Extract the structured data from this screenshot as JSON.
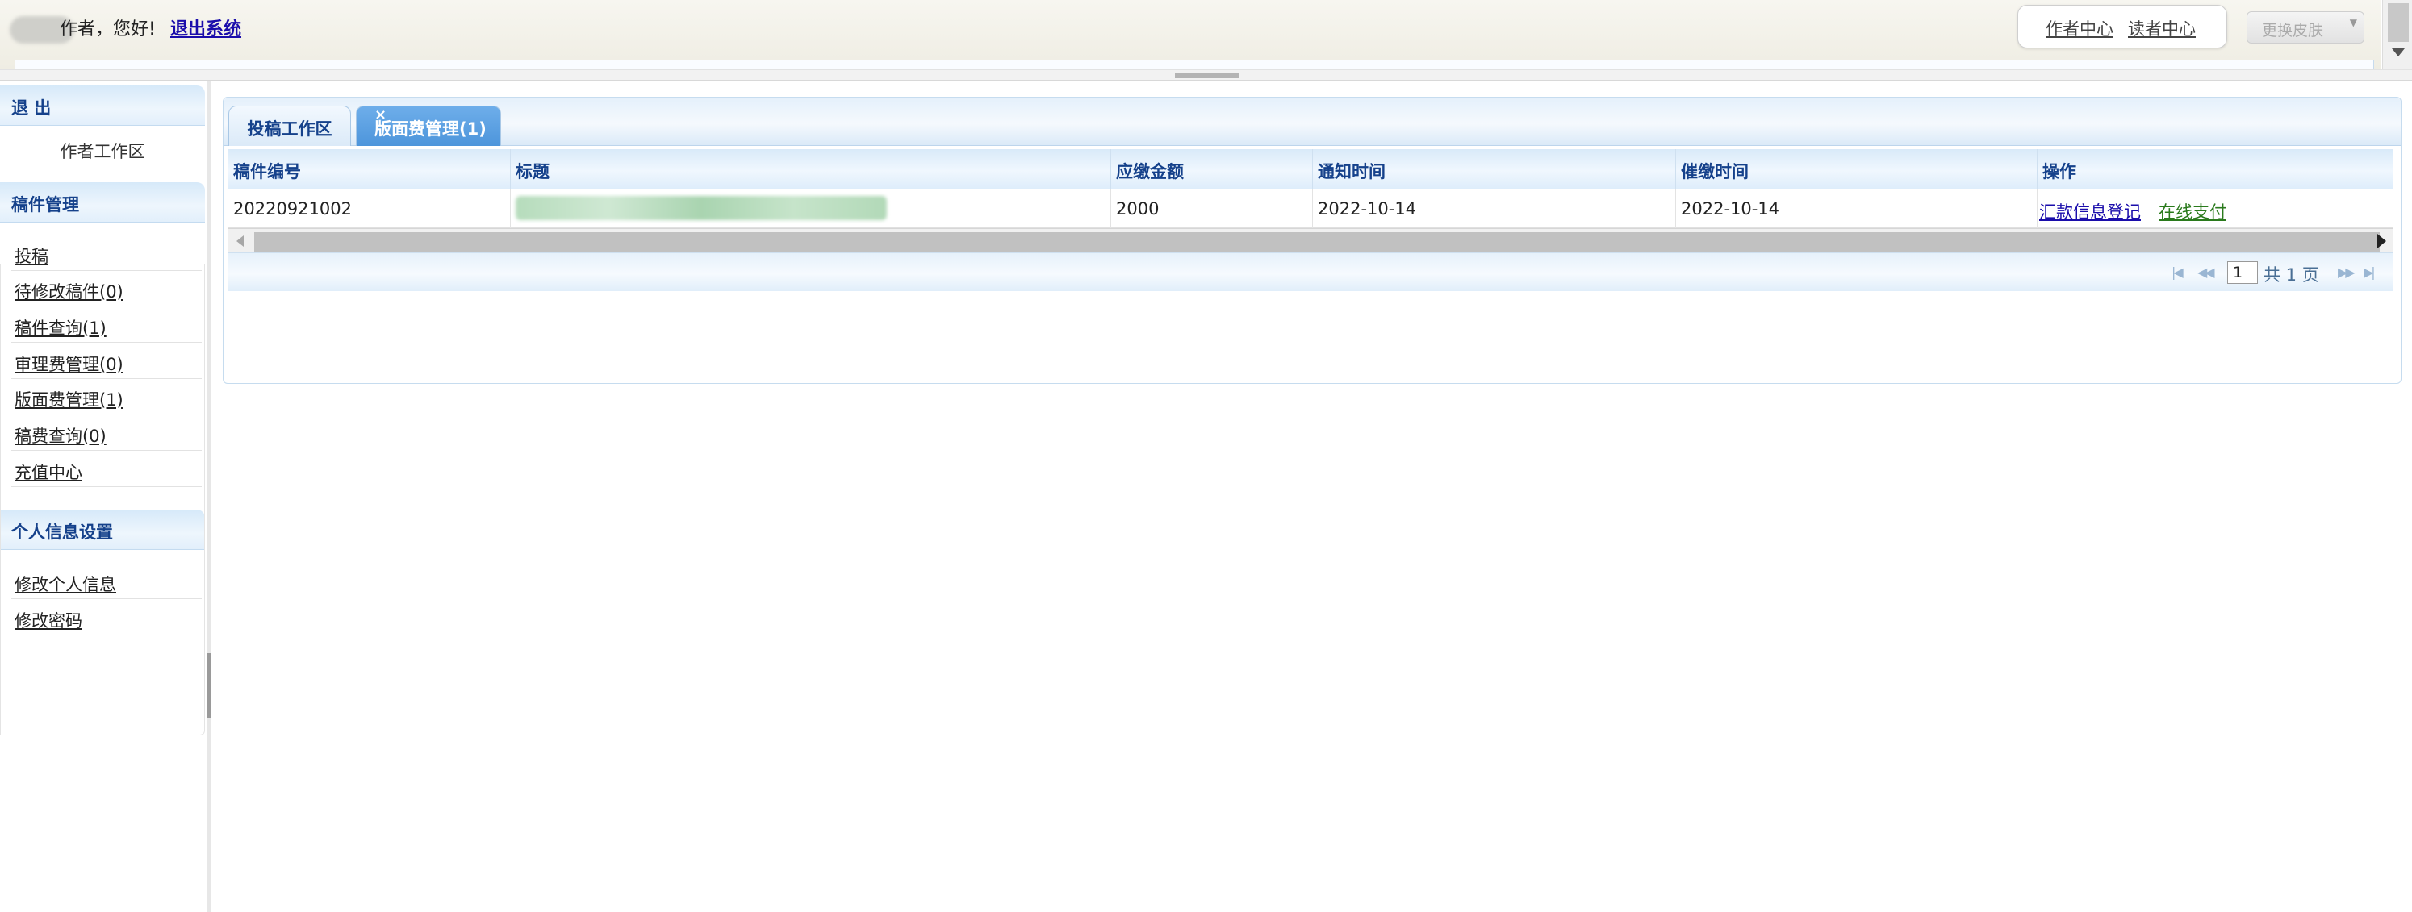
{
  "header": {
    "greeting": "作者，您好!",
    "logout_link": "退出系统",
    "author_center": "作者中心",
    "reader_center": "读者中心",
    "change_skin": "更换皮肤"
  },
  "sidebar": {
    "exit_header": "退 出",
    "workspace_link": "作者工作区",
    "manuscript_section": "稿件管理",
    "manuscript_items": [
      {
        "label": "投稿"
      },
      {
        "label": "待修改稿件(0)"
      },
      {
        "label": "稿件查询(1)"
      },
      {
        "label": "审理费管理(0)"
      },
      {
        "label": "版面费管理(1)"
      },
      {
        "label": "稿费查询(0)"
      },
      {
        "label": "充值中心"
      }
    ],
    "personal_section": "个人信息设置",
    "personal_items": [
      {
        "label": "修改个人信息"
      },
      {
        "label": "修改密码"
      }
    ]
  },
  "tabs": [
    {
      "label": "投稿工作区",
      "active": false
    },
    {
      "label": "版面费管理(1)",
      "active": true,
      "close_icon": "close-icon"
    }
  ],
  "table": {
    "columns": [
      "稿件编号",
      "标题",
      "应缴金额",
      "通知时间",
      "催缴时间",
      "操作"
    ],
    "rows": [
      {
        "manuscript_no": "20220921002",
        "title": "",
        "amount": "2000",
        "notice_time": "2022-10-14",
        "reminder_time": "2022-10-14",
        "actions": [
          "汇款信息登记",
          "在线支付"
        ]
      }
    ]
  },
  "pager": {
    "page_value": "1",
    "total_text": "共 1 页"
  },
  "colors": {
    "link_blue": "#1a0dab",
    "pay_green": "#2a7a1c",
    "header_text": "#15418b",
    "active_tab": "#5ba0e0"
  }
}
